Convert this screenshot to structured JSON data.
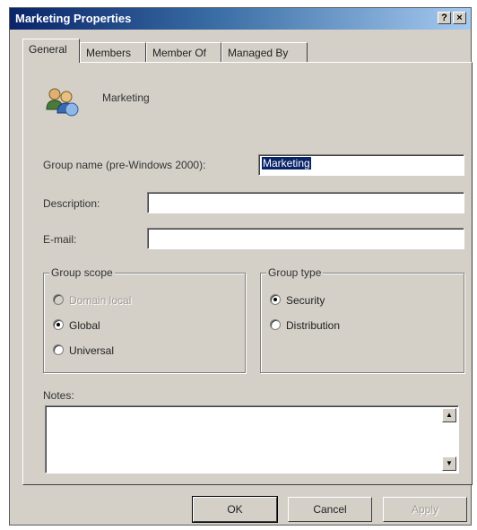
{
  "window": {
    "title": "Marketing Properties",
    "help_label": "?",
    "close_label": "×"
  },
  "tabs": [
    {
      "label": "General",
      "active": true
    },
    {
      "label": "Members",
      "active": false
    },
    {
      "label": "Member Of",
      "active": false
    },
    {
      "label": "Managed By",
      "active": false
    }
  ],
  "general": {
    "group_display_name": "Marketing",
    "group_icon": "group-icon",
    "group_name_label": "Group name (pre-Windows 2000):",
    "group_name_value": "Marketing",
    "description_label": "Description:",
    "description_value": "",
    "email_label": "E-mail:",
    "email_value": "",
    "group_scope": {
      "legend": "Group scope",
      "options": [
        {
          "label": "Domain local",
          "selected": false,
          "enabled": false
        },
        {
          "label": "Global",
          "selected": true,
          "enabled": true
        },
        {
          "label": "Universal",
          "selected": false,
          "enabled": true
        }
      ]
    },
    "group_type": {
      "legend": "Group type",
      "options": [
        {
          "label": "Security",
          "selected": true,
          "enabled": true
        },
        {
          "label": "Distribution",
          "selected": false,
          "enabled": true
        }
      ]
    },
    "notes_label": "Notes:",
    "notes_value": ""
  },
  "buttons": {
    "ok": "OK",
    "cancel": "Cancel",
    "apply": "Apply"
  },
  "colors": {
    "dialog_bg": "#d4d0c8",
    "title_start": "#0a246a",
    "title_end": "#a6caf0",
    "selection": "#0a246a"
  }
}
